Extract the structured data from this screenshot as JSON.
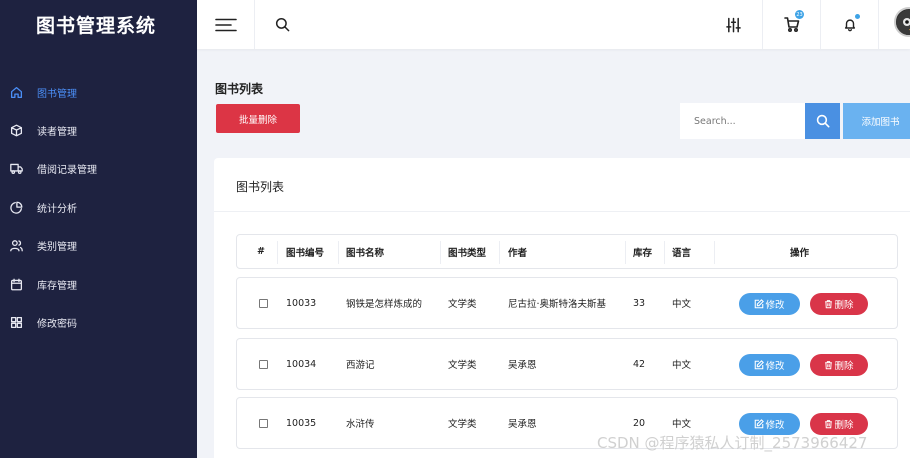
{
  "app": {
    "title": "图书管理系统"
  },
  "sidebar": {
    "items": [
      {
        "label": "图书管理",
        "icon": "home-icon",
        "active": true
      },
      {
        "label": "读者管理",
        "icon": "box-icon",
        "active": false
      },
      {
        "label": "借阅记录管理",
        "icon": "truck-icon",
        "active": false
      },
      {
        "label": "统计分析",
        "icon": "pie-chart-icon",
        "active": false
      },
      {
        "label": "类别管理",
        "icon": "users-icon",
        "active": false
      },
      {
        "label": "库存管理",
        "icon": "calendar-icon",
        "active": false
      },
      {
        "label": "修改密码",
        "icon": "grid-icon",
        "active": false
      }
    ]
  },
  "topbar": {
    "cart_count": "23"
  },
  "page": {
    "title": "图书列表",
    "batch_delete_label": "批量删除",
    "search_placeholder": "Search...",
    "add_label": "添加图书"
  },
  "table": {
    "title": "图书列表",
    "headers": [
      "#",
      "图书编号",
      "图书名称",
      "图书类型",
      "作者",
      "库存",
      "语言",
      "操作"
    ],
    "edit_label": "修改",
    "delete_label": "删除",
    "rows": [
      {
        "id": "10033",
        "name": "钢铁是怎样炼成的",
        "type": "文学类",
        "author": "尼古拉·奥斯特洛夫斯基",
        "stock": "33",
        "lang": "中文"
      },
      {
        "id": "10034",
        "name": "西游记",
        "type": "文学类",
        "author": "吴承恩",
        "stock": "42",
        "lang": "中文"
      },
      {
        "id": "10035",
        "name": "水浒传",
        "type": "文学类",
        "author": "吴承恩",
        "stock": "20",
        "lang": "中文"
      }
    ]
  },
  "watermark": "CSDN @程序猿私人订制_2573966427",
  "colors": {
    "sidebar_bg": "#1e2240",
    "active": "#4b8ff7",
    "danger": "#dc3545",
    "primary": "#4a90e2"
  }
}
